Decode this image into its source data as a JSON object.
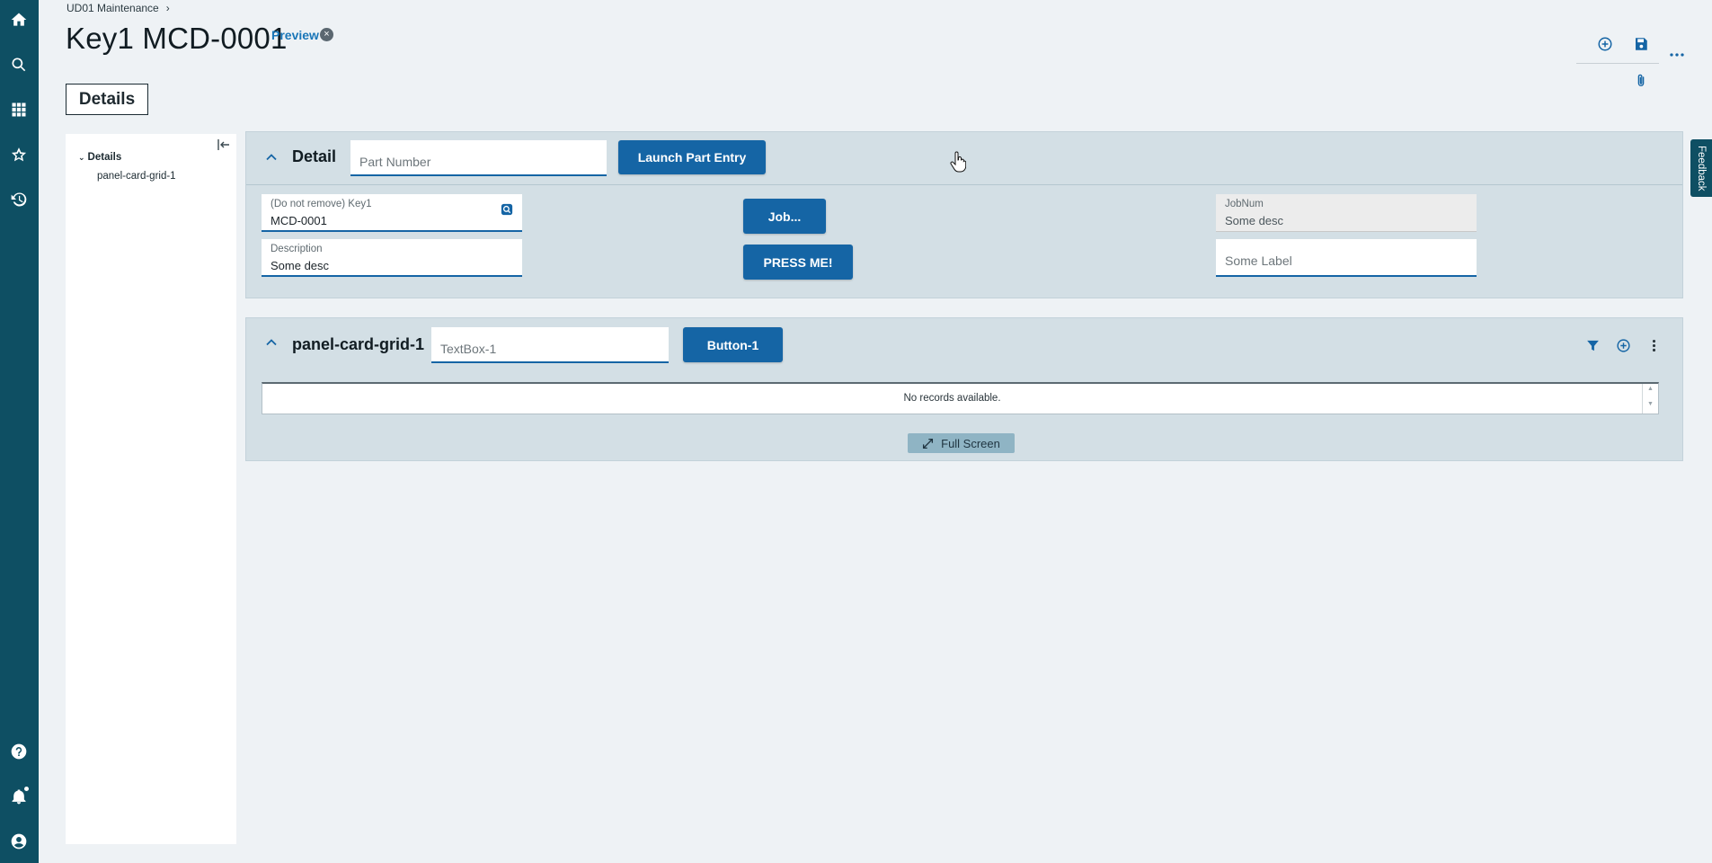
{
  "breadcrumb": {
    "parent": "UD01 Maintenance",
    "separator": "›"
  },
  "header": {
    "title": "Key1 MCD-0001",
    "preview_label": "Preview",
    "preview_close_glyph": "×"
  },
  "rail": {
    "icons": [
      "home-icon",
      "search-icon",
      "apps-icon",
      "star-icon",
      "history-icon",
      "help-icon",
      "bell-icon",
      "user-icon"
    ]
  },
  "tabs": {
    "details": "Details"
  },
  "tree": {
    "root": "Details",
    "child": "panel-card-grid-1",
    "toggle_glyph": "⌄"
  },
  "detail_card": {
    "title": "Detail",
    "part_number_placeholder": "Part Number",
    "launch_button": "Launch Part Entry",
    "key1_label": "(Do not remove) Key1",
    "key1_value": "MCD-0001",
    "description_label": "Description",
    "description_value": "Some desc",
    "job_button": "Job...",
    "press_button": "PRESS ME!",
    "jobnum_label": "JobNum",
    "jobnum_value": "Some desc",
    "some_label_placeholder": "Some Label"
  },
  "grid_card": {
    "title": "panel-card-grid-1",
    "textbox_placeholder": "TextBox-1",
    "button_label": "Button-1",
    "empty_message": "No records available.",
    "fullscreen_label": "Full Screen",
    "scroll_up": "▲",
    "scroll_down": "▼"
  },
  "feedback": "Feedback",
  "colors": {
    "rail": "#0e4f63",
    "primary": "#1565a5",
    "card": "#d3dfe5"
  }
}
